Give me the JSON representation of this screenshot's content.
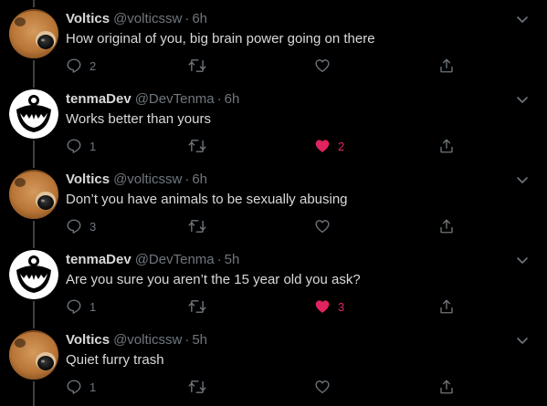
{
  "colors": {
    "background": "#000000",
    "text": "#d9d9d9",
    "muted": "#6e767d",
    "like_active": "#e0245e",
    "thread_line": "#3d4043"
  },
  "tweets": [
    {
      "name": "Voltics",
      "handle": "@volticssw",
      "time": "6h",
      "text": "How original of you, big brain power going on there",
      "replies": "2",
      "retweets": "",
      "likes": "",
      "liked": false,
      "avatar": "dog-avatar"
    },
    {
      "name": "tenmaDev",
      "handle": "@DevTenma",
      "time": "6h",
      "text": "Works better than yours",
      "replies": "1",
      "retweets": "",
      "likes": "2",
      "liked": true,
      "avatar": "grin-mask-avatar"
    },
    {
      "name": "Voltics",
      "handle": "@volticssw",
      "time": "6h",
      "text": "Don’t you have animals to be sexually abusing",
      "replies": "3",
      "retweets": "",
      "likes": "",
      "liked": false,
      "avatar": "dog-avatar"
    },
    {
      "name": "tenmaDev",
      "handle": "@DevTenma",
      "time": "5h",
      "text": "Are you sure you aren’t the 15 year old you ask?",
      "replies": "1",
      "retweets": "",
      "likes": "3",
      "liked": true,
      "avatar": "grin-mask-avatar"
    },
    {
      "name": "Voltics",
      "handle": "@volticssw",
      "time": "5h",
      "text": "Quiet furry trash",
      "replies": "1",
      "retweets": "",
      "likes": "",
      "liked": false,
      "avatar": "dog-avatar"
    }
  ]
}
